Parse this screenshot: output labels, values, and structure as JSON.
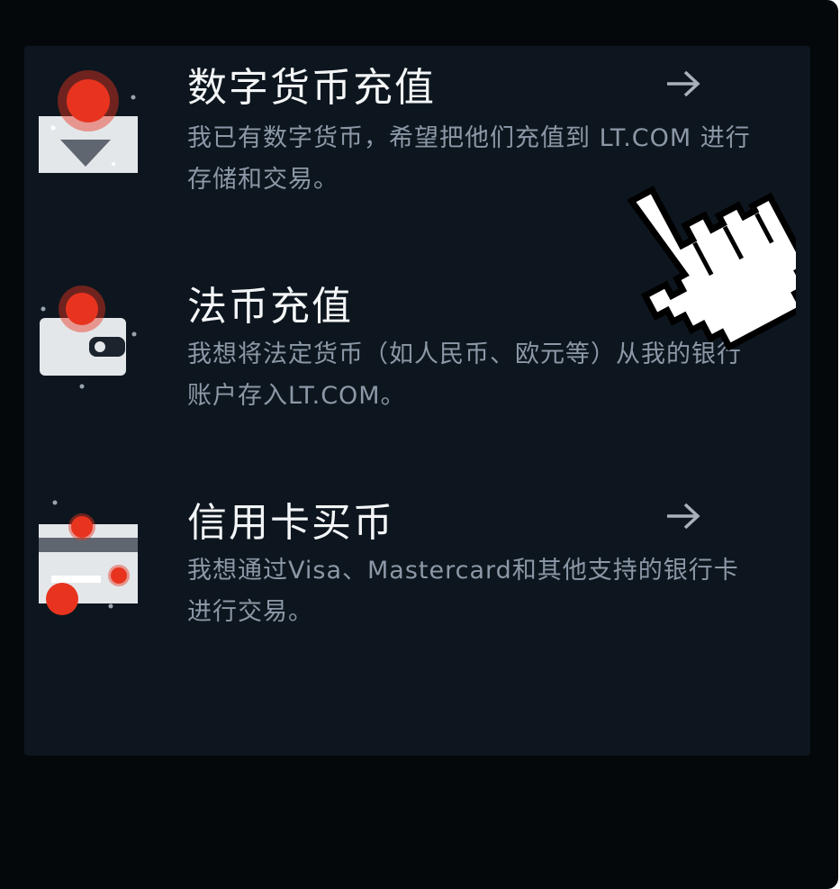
{
  "options": [
    {
      "title": "数字货币充值",
      "description": "我已有数字货币，希望把他们充值到 LT.COM 进行存储和交易。",
      "icon": "crypto-deposit-envelope-icon",
      "has_arrow": true
    },
    {
      "title": "法币充值",
      "description": "我想将法定货币（如人民币、欧元等）从我的银行账户存入LT.COM。",
      "icon": "fiat-wallet-icon",
      "has_arrow": false
    },
    {
      "title": "信用卡买币",
      "description": "我想通过Visa、Mastercard和其他支持的银行卡进行交易。",
      "icon": "credit-card-icon",
      "has_arrow": true
    }
  ],
  "colors": {
    "background": "#05080b",
    "panel": "#0d161e",
    "title": "#f3f5f7",
    "description": "#8c98a7",
    "accent_red": "#e8341f",
    "icon_light": "#e4e7ea",
    "arrow": "#a9b1bb"
  },
  "overlay": {
    "icon": "pointing-hand-cursor-icon"
  }
}
